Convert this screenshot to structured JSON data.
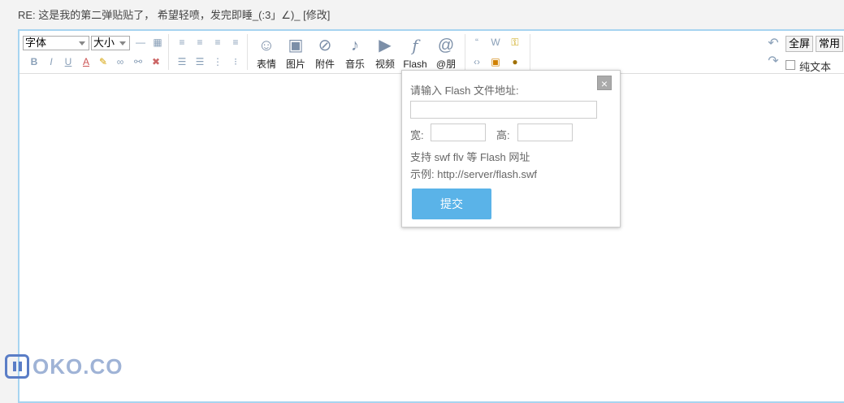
{
  "post": {
    "title_line": "RE: 这是我的第二弹贴贴了， 希望轻喷，发完即睡_(:3」∠)_ [修改]"
  },
  "toolbar": {
    "font_select": "字体",
    "size_select": "大小",
    "row1_icons": [
      "hr-icon",
      "table-icon",
      "align-left-icon",
      "align-center-icon",
      "align-right-icon",
      "align-justify-icon"
    ],
    "row2_icons": [
      "bold-icon",
      "italic-icon",
      "underline-icon",
      "font-color-icon",
      "highlight-icon",
      "link-icon",
      "unlink-icon",
      "clear-format-icon"
    ],
    "format_labels": {
      "bold": "B",
      "italic": "I",
      "underline": "U",
      "font_color": "A"
    },
    "insert_buttons": [
      {
        "label": "表情",
        "icon": "smiley-icon"
      },
      {
        "label": "图片",
        "icon": "image-icon"
      },
      {
        "label": "附件",
        "icon": "paperclip-icon"
      },
      {
        "label": "音乐",
        "icon": "music-icon"
      },
      {
        "label": "视频",
        "icon": "play-icon"
      },
      {
        "label": "Flash",
        "icon": "flash-icon"
      },
      {
        "label": "@朋",
        "icon": "at-icon"
      }
    ],
    "fullscreen_label": "全屏",
    "common_label": "常用",
    "plaintext_label": "纯文本"
  },
  "flash_dialog": {
    "prompt": "请输入 Flash 文件地址:",
    "url_value": "",
    "width_label": "宽:",
    "width_value": "",
    "height_label": "高:",
    "height_value": "",
    "support_note": "支持 swf flv 等 Flash 网址",
    "example": "示例: http://server/flash.swf",
    "submit_label": "提交",
    "close_glyph": "×"
  },
  "watermark": {
    "text": "OKO.CO"
  }
}
